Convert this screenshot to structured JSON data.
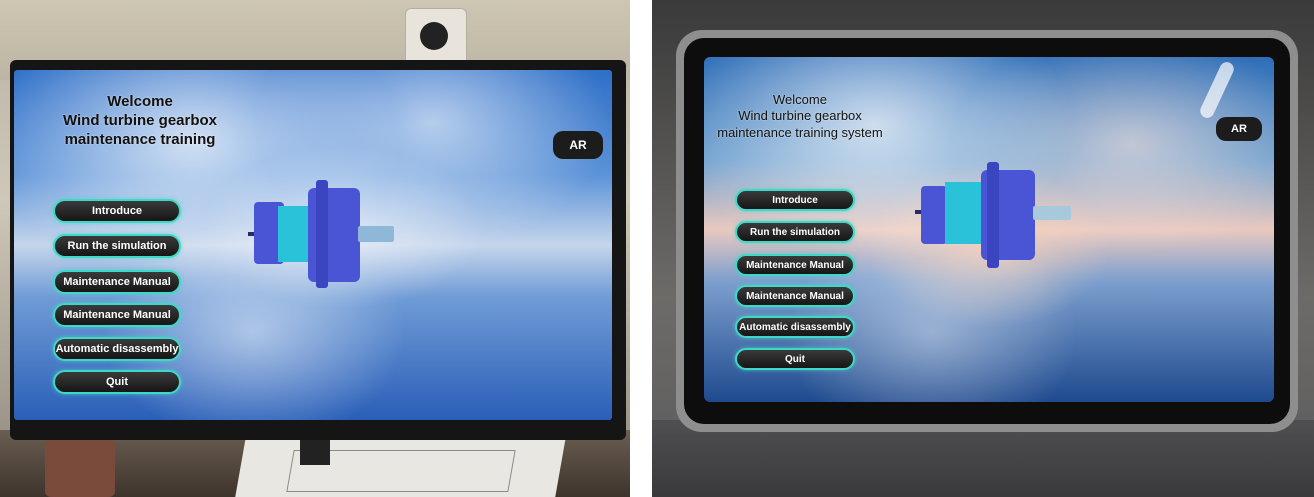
{
  "left_display": {
    "title_lines": [
      "Welcome",
      "Wind turbine gearbox",
      "maintenance training"
    ],
    "ar_button": "AR",
    "menu": [
      "Introduce",
      "Run the simulation",
      "Maintenance Manual",
      "Maintenance Manual",
      "Automatic disassembly",
      "Quit"
    ]
  },
  "right_display": {
    "title_lines": [
      "Welcome",
      "Wind turbine gearbox",
      "maintenance training system"
    ],
    "ar_button": "AR",
    "menu": [
      "Introduce",
      "Run the simulation",
      "Maintenance Manual",
      "Maintenance Manual",
      "Automatic disassembly",
      "Quit"
    ]
  },
  "colors": {
    "button_border": "#3fd8c8",
    "button_fill": "#1e1e1e",
    "gearbox_blue": "#4a55d6",
    "gearbox_cyan": "#29c2d8"
  }
}
